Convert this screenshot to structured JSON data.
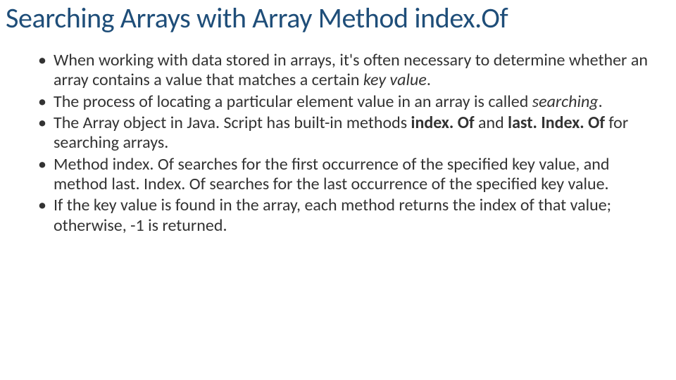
{
  "title": "Searching Arrays with Array Method index.Of",
  "bullets": [
    {
      "pre": "When working with data stored in arrays, it's often necessary to determine whether an array contains a value that matches a certain ",
      "emph": "key value",
      "emph_class": "italic",
      "post": "."
    },
    {
      "pre": "The process of locating a particular element value in an array is called ",
      "emph": "searching",
      "emph_class": "italic",
      "post": "."
    },
    {
      "pre": "The Array object in Java. Script has built-in methods ",
      "emph": "index. Of",
      "emph_class": "bold",
      "mid": " and ",
      "emph2": "last. Index. Of",
      "emph2_class": "bold",
      "post": " for searching arrays."
    },
    {
      "pre": "Method index. Of searches for the first occurrence of the specified key value, and method last. Index. Of searches for the last occurrence of the specified key value.",
      "emph": "",
      "emph_class": "",
      "post": ""
    },
    {
      "pre": "If the key value is found in the array, each method returns the index of that value; otherwise, -1 is returned.",
      "emph": "",
      "emph_class": "",
      "post": ""
    }
  ]
}
